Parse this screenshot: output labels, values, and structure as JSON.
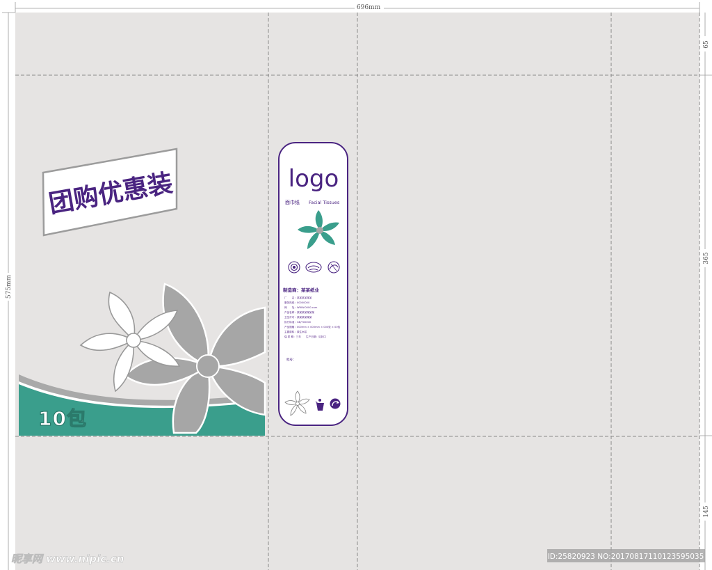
{
  "dimensions": {
    "width": "696mm",
    "height": "575mm",
    "top_fold": "65",
    "middle": "365",
    "bottom_fold": "145"
  },
  "front": {
    "promo_text": "团购优惠装",
    "count_text": "10包",
    "colors": {
      "teal": "#3a9e8c",
      "gray": "#a6a6a6",
      "purple": "#4a2481",
      "paper": "#e6e4e3"
    }
  },
  "side_label": {
    "logo": "logo",
    "product_cn": "面巾纸",
    "product_en": "Facial Tissues",
    "maker_title": "制造商：某某纸业",
    "info_lines": [
      "厂　　名：某某某某某某",
      "服务热线：00000000",
      "网　　址：WWW.0000.com",
      "产品名称：某某某某某某某",
      "卫生许可：某某某某某某",
      "执行标准：GB/T00000",
      "产品规格：000mm × 000mm × 000张 × 00包",
      "主要原料：原生木浆",
      "保 质 期：三年　　生产日期：见封口"
    ],
    "batch_label": "批号："
  },
  "watermark": {
    "site": "昵享网 www.nipic.cn",
    "id": "ID:25820923 NO:20170817110123595035"
  }
}
